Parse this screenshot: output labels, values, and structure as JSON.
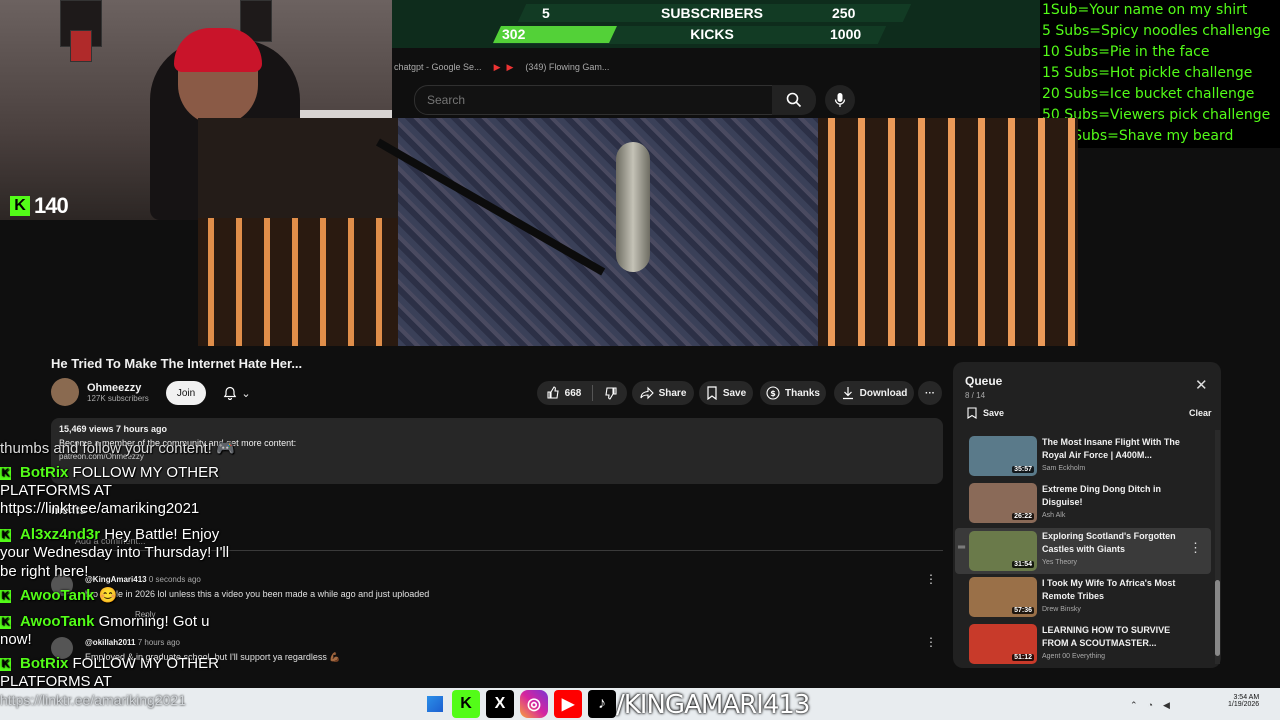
{
  "webcam": {
    "kicks_count": "140"
  },
  "goal": {
    "row1": {
      "current": "5",
      "label": "SUBSCRIBERS",
      "target": "250",
      "progress": 0.02
    },
    "row2": {
      "current": "302",
      "label": "KICKS",
      "target": "1000",
      "progress": 0.302
    }
  },
  "browser_tabs": [
    "chatgpt - Google Se...",
    "(349) Flowing Gam..."
  ],
  "sub_goals": [
    "1Sub=Your name on my shirt",
    "5 Subs=Spicy noodles challenge",
    "10 Subs=Pie in the face",
    "15 Subs=Hot pickle challenge",
    "20 Subs=Ice bucket challenge",
    "50 Subs=Viewers pick challenge",
    "100 Subs=Shave my beard"
  ],
  "search": {
    "placeholder": "Search"
  },
  "video": {
    "title": "He Tried To Make The Internet Hate Her...",
    "channel": "Ohmeezzy",
    "subscribers": "127K subscribers",
    "join_label": "Join",
    "likes": "668",
    "share_label": "Share",
    "save_label": "Save",
    "thanks_label": "Thanks",
    "download_label": "Download"
  },
  "description": {
    "meta": "15,469 views  7 hours ago",
    "line": "Become a member of the community and get more content:",
    "link": "patreon.com/Ohmeezzy"
  },
  "comments": {
    "header": "ments",
    "add_placeholder": "Add a comment...",
    "items": [
      {
        "user": "@KingAmari413",
        "time": "0 seconds ago",
        "text": "bro made in 2026 lol unless this a video you been made a while ago and just uploaded",
        "reply": "Reply"
      },
      {
        "user": "@okillah2011",
        "time": "7 hours ago",
        "text": "Employed & in graduate school, but I'll support ya regardless 💪🏾",
        "reply": ""
      }
    ]
  },
  "chat": [
    {
      "user": "",
      "text": "thumbs and follow your content! 🎮"
    },
    {
      "user": "BotRix",
      "text": "FOLLOW MY OTHER PLATFORMS AT"
    },
    {
      "user": "",
      "text": "https://linktr.ee/amariking2021"
    },
    {
      "user": "Al3xz4nd3r",
      "text": "Hey Battle! Enjoy"
    },
    {
      "user": "",
      "text": "your Wednesday into Thursday! I'll"
    },
    {
      "user": "",
      "text": "be right here!"
    },
    {
      "user": "AwooTank",
      "text": "😊"
    },
    {
      "user": "AwooTank",
      "text": "Gmorning! Got u"
    },
    {
      "user": "",
      "text": "now!"
    },
    {
      "user": "BotRix",
      "text": "FOLLOW MY OTHER"
    },
    {
      "user": "",
      "text": "PLATFORMS AT"
    }
  ],
  "chat_link": "https://linktr.ee/amariking2021",
  "queue": {
    "title": "Queue",
    "count": "8 / 14",
    "save_label": "Save",
    "clear_label": "Clear",
    "items": [
      {
        "title": "The Most Insane Flight With The Royal Air Force | A400M...",
        "channel": "Sam Eckholm",
        "duration": "35:57",
        "color": "#5a7a8a"
      },
      {
        "title": "Extreme Ding Dong Ditch in Disguise!",
        "channel": "Ash Alk",
        "duration": "26:22",
        "color": "#8a6a58"
      },
      {
        "title": "Exploring Scotland's Forgotten Castles with Giants",
        "channel": "Yes Theory",
        "duration": "31:54",
        "color": "#6a7a4a"
      },
      {
        "title": "I Took My Wife To Africa's Most Remote Tribes",
        "channel": "Drew Binsky",
        "duration": "57:36",
        "color": "#9a7048"
      },
      {
        "title": "LEARNING HOW TO SURVIVE FROM A SCOUTMASTER...",
        "channel": "Agent 00 Everything",
        "duration": "51:12",
        "color": "#c83a2a"
      }
    ]
  },
  "stream_handle": "/KINGAMARI413",
  "clock": {
    "time": "3:54 AM",
    "date": "1/19/2026"
  }
}
